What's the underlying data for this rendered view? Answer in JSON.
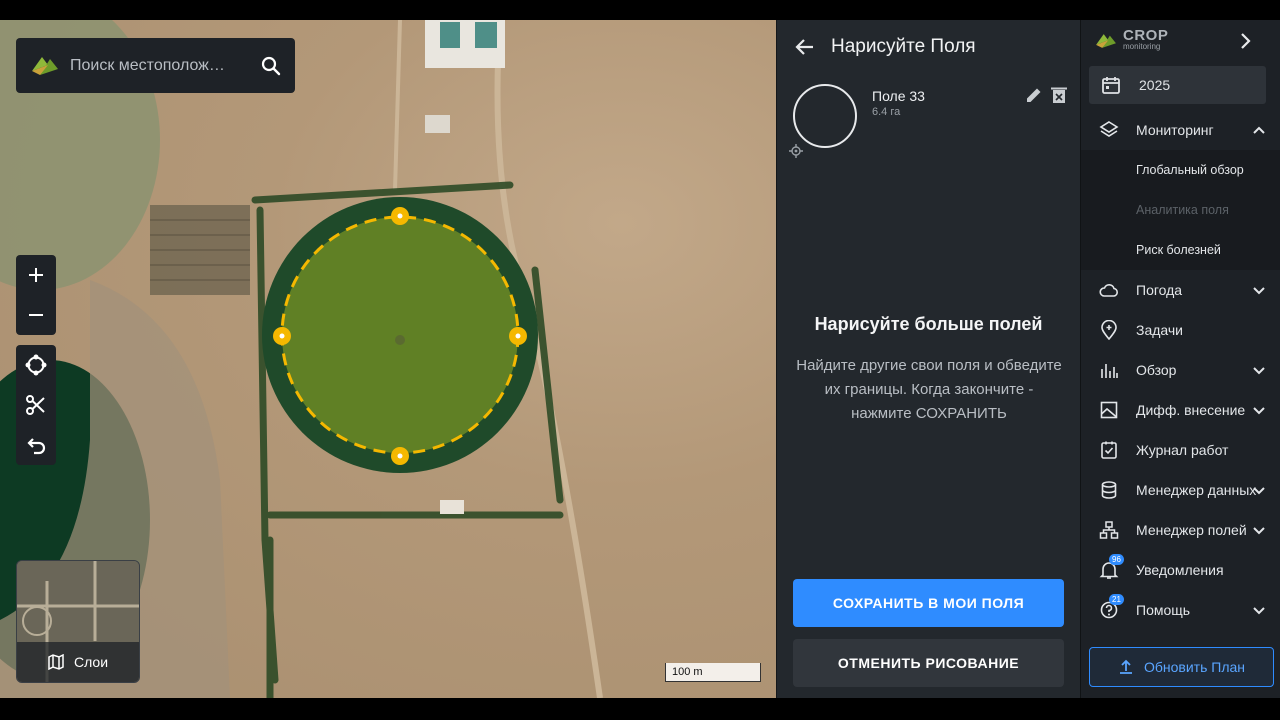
{
  "search": {
    "placeholder": "Поиск местополож…"
  },
  "map": {
    "scale_label": "100 m",
    "layers_label": "Слои"
  },
  "draw_panel": {
    "title": "Нарисуйте Поля",
    "field": {
      "name": "Поле 33",
      "area": "6.4 га"
    },
    "empty_title": "Нарисуйте больше полей",
    "empty_desc": "Найдите другие свои поля и обведите их границы. Когда закончите - нажмите СОХРАНИТЬ",
    "save_label": "СОХРАНИТЬ В МОИ ПОЛЯ",
    "cancel_label": "ОТМЕНИТЬ РИСОВАНИЕ"
  },
  "nav": {
    "brand": "CROP",
    "brand_sub": "monitoring",
    "year": "2025",
    "monitoring": "Мониторинг",
    "sub_items": [
      {
        "label": "Глобальный обзор",
        "enabled": true
      },
      {
        "label": "Аналитика поля",
        "enabled": false
      },
      {
        "label": "Риск болезней",
        "enabled": true
      }
    ],
    "weather": "Погода",
    "tasks": "Задачи",
    "overview": "Обзор",
    "vra": "Дифф. внесение",
    "journal": "Журнал работ",
    "data_manager": "Менеджер данных",
    "field_manager": "Менеджер полей",
    "notifications": "Уведомления",
    "notifications_count": "96",
    "help": "Помощь",
    "help_count": "21",
    "upgrade_label": "Обновить План"
  },
  "colors": {
    "accent": "#2f8cff",
    "draw": "#f5b800",
    "panel": "#23282d"
  }
}
